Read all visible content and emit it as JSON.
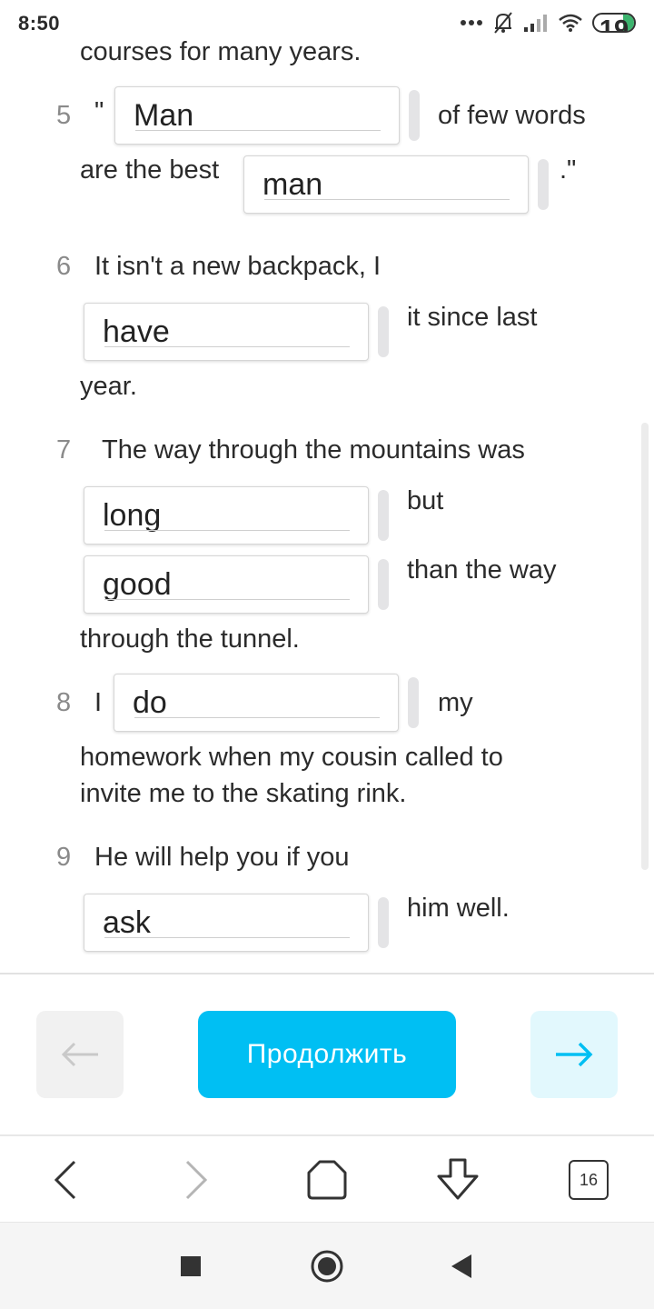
{
  "status_bar": {
    "time": "8:50",
    "battery": "19"
  },
  "exercise": {
    "lines": {
      "top_fragment": "courses for many years.",
      "q5_quote_open": "\"",
      "q5_after1": "of few words",
      "q5_line2": "are the best",
      "q5_end": ".\"",
      "q6_line1": "It isn't a new backpack, I",
      "q6_after": "it since last",
      "q6_line3": "year.",
      "q7_line1": "The way through the mountains was",
      "q7_after1": "but",
      "q7_after2": "than the way",
      "q7_line4": "through the tunnel.",
      "q8_pre": "I",
      "q8_after": "my",
      "q8_line2": "homework when my cousin called to",
      "q8_line3": "invite me to the skating rink.",
      "q9_line1": "He will help you if you",
      "q9_after": "him well."
    },
    "numbers": {
      "n5": "5",
      "n6": "6",
      "n7": "7",
      "n8": "8",
      "n9": "9"
    },
    "answers": {
      "a5_1": "Man",
      "a5_2": "man",
      "a6": "have",
      "a7_1": "long",
      "a7_2": "good",
      "a8": "do",
      "a9": "ask"
    }
  },
  "actions": {
    "continue_label": "Продолжить"
  },
  "browser": {
    "tabs_count": "16"
  },
  "colors": {
    "accent": "#00bff3",
    "next_bg": "#e2f8fd",
    "prev_bg": "#f1f1f1"
  }
}
